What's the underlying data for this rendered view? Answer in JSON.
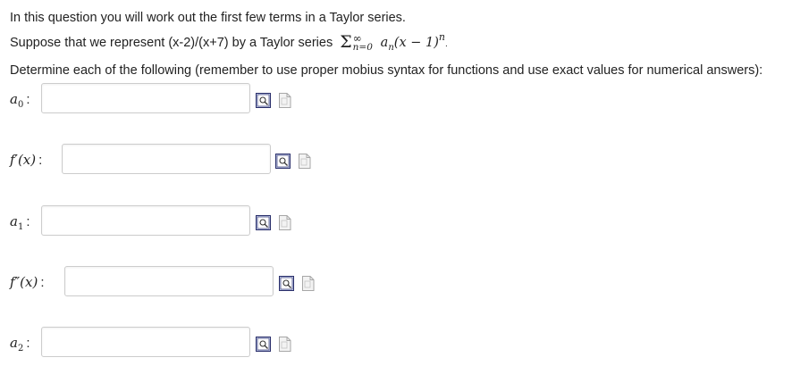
{
  "intro_text": "In this question you will work out the first few terms in a Taylor series.",
  "suppose_text": "Suppose that we represent (x-2)/(x+7) by a Taylor series",
  "series": {
    "sum_symbol": "Σ",
    "upper": "∞",
    "lower": "n=0",
    "term_a": "a",
    "term_sub": "n",
    "term_mid": "(x − 1)",
    "term_exp": "n",
    "period": "."
  },
  "instruction_text": "Determine each of the following (remember to use proper mobius syntax for functions and use exact values for numerical answers):",
  "fields": [
    {
      "label_main": "a",
      "label_sub": "0",
      "label_suffix": "",
      "value": ""
    },
    {
      "label_main": "f′(x)",
      "label_sub": "",
      "label_suffix": "",
      "value": ""
    },
    {
      "label_main": "a",
      "label_sub": "1",
      "label_suffix": "",
      "value": ""
    },
    {
      "label_main": "f″(x)",
      "label_sub": "",
      "label_suffix": "",
      "value": ""
    },
    {
      "label_main": "a",
      "label_sub": "2",
      "label_suffix": "",
      "value": ""
    }
  ],
  "colon": ":",
  "icons": {
    "preview": "equation-preview-icon",
    "help": "page-help-icon"
  }
}
